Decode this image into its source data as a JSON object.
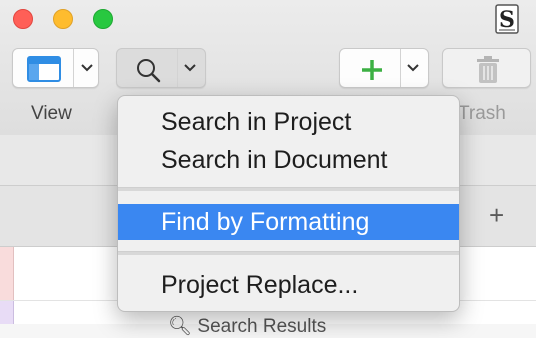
{
  "window": {
    "traffic_lights": [
      "close",
      "minimize",
      "zoom"
    ],
    "app_icon": "scrivener-app-icon"
  },
  "toolbar": {
    "view": {
      "label": "View",
      "icon": "layout-icon"
    },
    "search": {
      "icon": "magnifier-icon"
    },
    "add": {
      "icon": "plus-icon",
      "color": "#3cb043"
    },
    "trash": {
      "label": "Trash",
      "icon": "trash-icon"
    }
  },
  "search_menu": {
    "items": [
      {
        "label": "Search in Project"
      },
      {
        "label": "Search in Document"
      },
      {
        "label": "Find by Formatting",
        "highlighted": true
      },
      {
        "label": "Project Replace..."
      }
    ],
    "highlight_color": "#3a87f1"
  },
  "binder": {
    "add_icon": "+",
    "partial_row": "Search Results"
  }
}
